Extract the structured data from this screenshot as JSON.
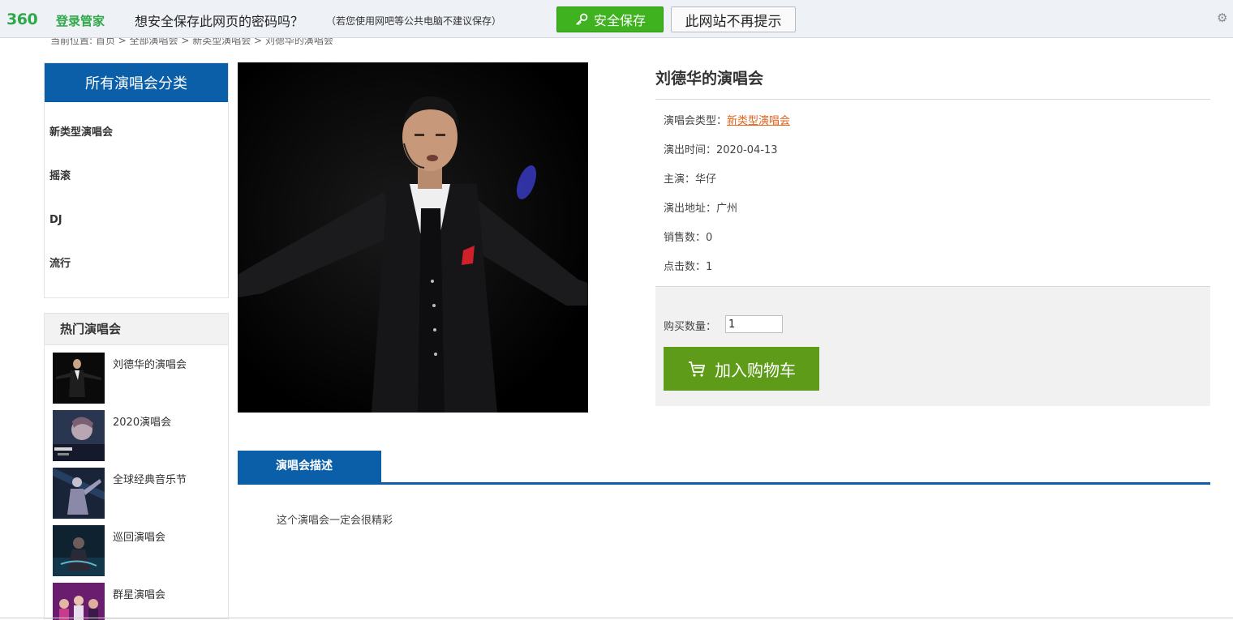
{
  "password_bar": {
    "logo": "360",
    "logo_text": "登录管家",
    "question": "想安全保存此网页的密码吗？",
    "note": "（若您使用网吧等公共电脑不建议保存）",
    "save_label": "安全保存",
    "never_label": "此网站不再提示",
    "save_color": "#3fb21f",
    "settings_icon": "gear-icon"
  },
  "breadcrumb": "当前位置: 首页 > 全部演唱会 > 新类型演唱会 > 刘德华的演唱会",
  "sidebar": {
    "category_title": "所有演唱会分类",
    "categories": [
      "新类型演唱会",
      "摇滚",
      "DJ",
      "流行"
    ],
    "hot_title": "热门演唱会",
    "hot_items": [
      "刘德华的演唱会",
      "2020演唱会",
      "全球经典音乐节",
      "巡回演唱会",
      "群星演唱会"
    ],
    "accent_color": "#0b5ea8"
  },
  "product": {
    "title": "刘德华的演唱会",
    "type_label": "演唱会类型：",
    "type_value": "新类型演唱会",
    "time": "演出时间：2020-04-13",
    "performer": "主演：华仔",
    "address": "演出地址：广州",
    "sales": "销售数：0",
    "clicks": "点击数：1",
    "quantity_label": "购买数量：",
    "quantity_value": "1",
    "cart_label": "加入购物车",
    "cart_color": "#5e9b18"
  },
  "description": {
    "tab_label": "演唱会描述",
    "text": "这个演唱会一定会很精彩"
  }
}
